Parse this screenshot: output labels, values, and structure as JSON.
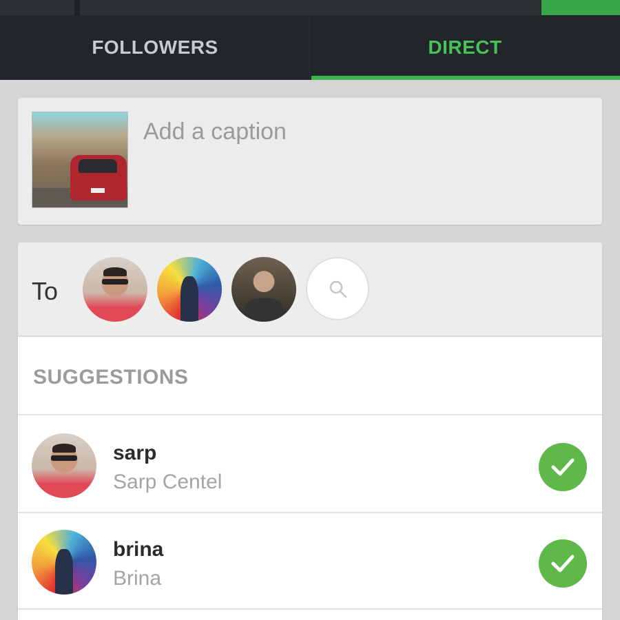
{
  "tabs": [
    {
      "label": "FOLLOWERS",
      "active": false
    },
    {
      "label": "DIRECT",
      "active": true
    }
  ],
  "caption": {
    "placeholder": "Add a caption",
    "value": ""
  },
  "recipients": {
    "to_label": "To",
    "selected": [
      "sarp",
      "brina",
      "third-recipient"
    ],
    "search_icon": "search-icon"
  },
  "suggestions": {
    "heading": "SUGGESTIONS",
    "items": [
      {
        "username": "sarp",
        "full_name": "Sarp Centel",
        "selected": true
      },
      {
        "username": "brina",
        "full_name": "Brina",
        "selected": true
      }
    ]
  },
  "colors": {
    "accent": "#48c15a",
    "tab_bar": "#22262a",
    "check": "#5fb848",
    "muted_text": "#a4a4a4"
  }
}
